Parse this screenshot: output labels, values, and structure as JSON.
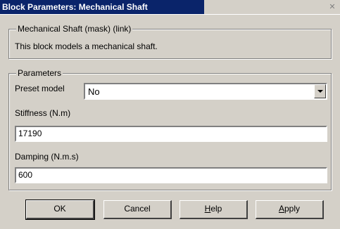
{
  "window": {
    "title": "Block Parameters: Mechanical Shaft",
    "colors": {
      "titlebar_active": "#0a246a",
      "face": "#d4d0c8"
    }
  },
  "description_group": {
    "legend": "Mechanical Shaft (mask) (link)",
    "text": "This block models a mechanical shaft."
  },
  "parameters_group": {
    "legend": "Parameters",
    "preset": {
      "label": "Preset model",
      "value": "No"
    },
    "stiffness": {
      "label": "Stiffness (N.m)",
      "value": "17190"
    },
    "damping": {
      "label": "Damping (N.m.s)",
      "value": "600"
    }
  },
  "buttons": {
    "ok": "OK",
    "cancel": "Cancel",
    "help": "Help",
    "apply": "Apply"
  }
}
